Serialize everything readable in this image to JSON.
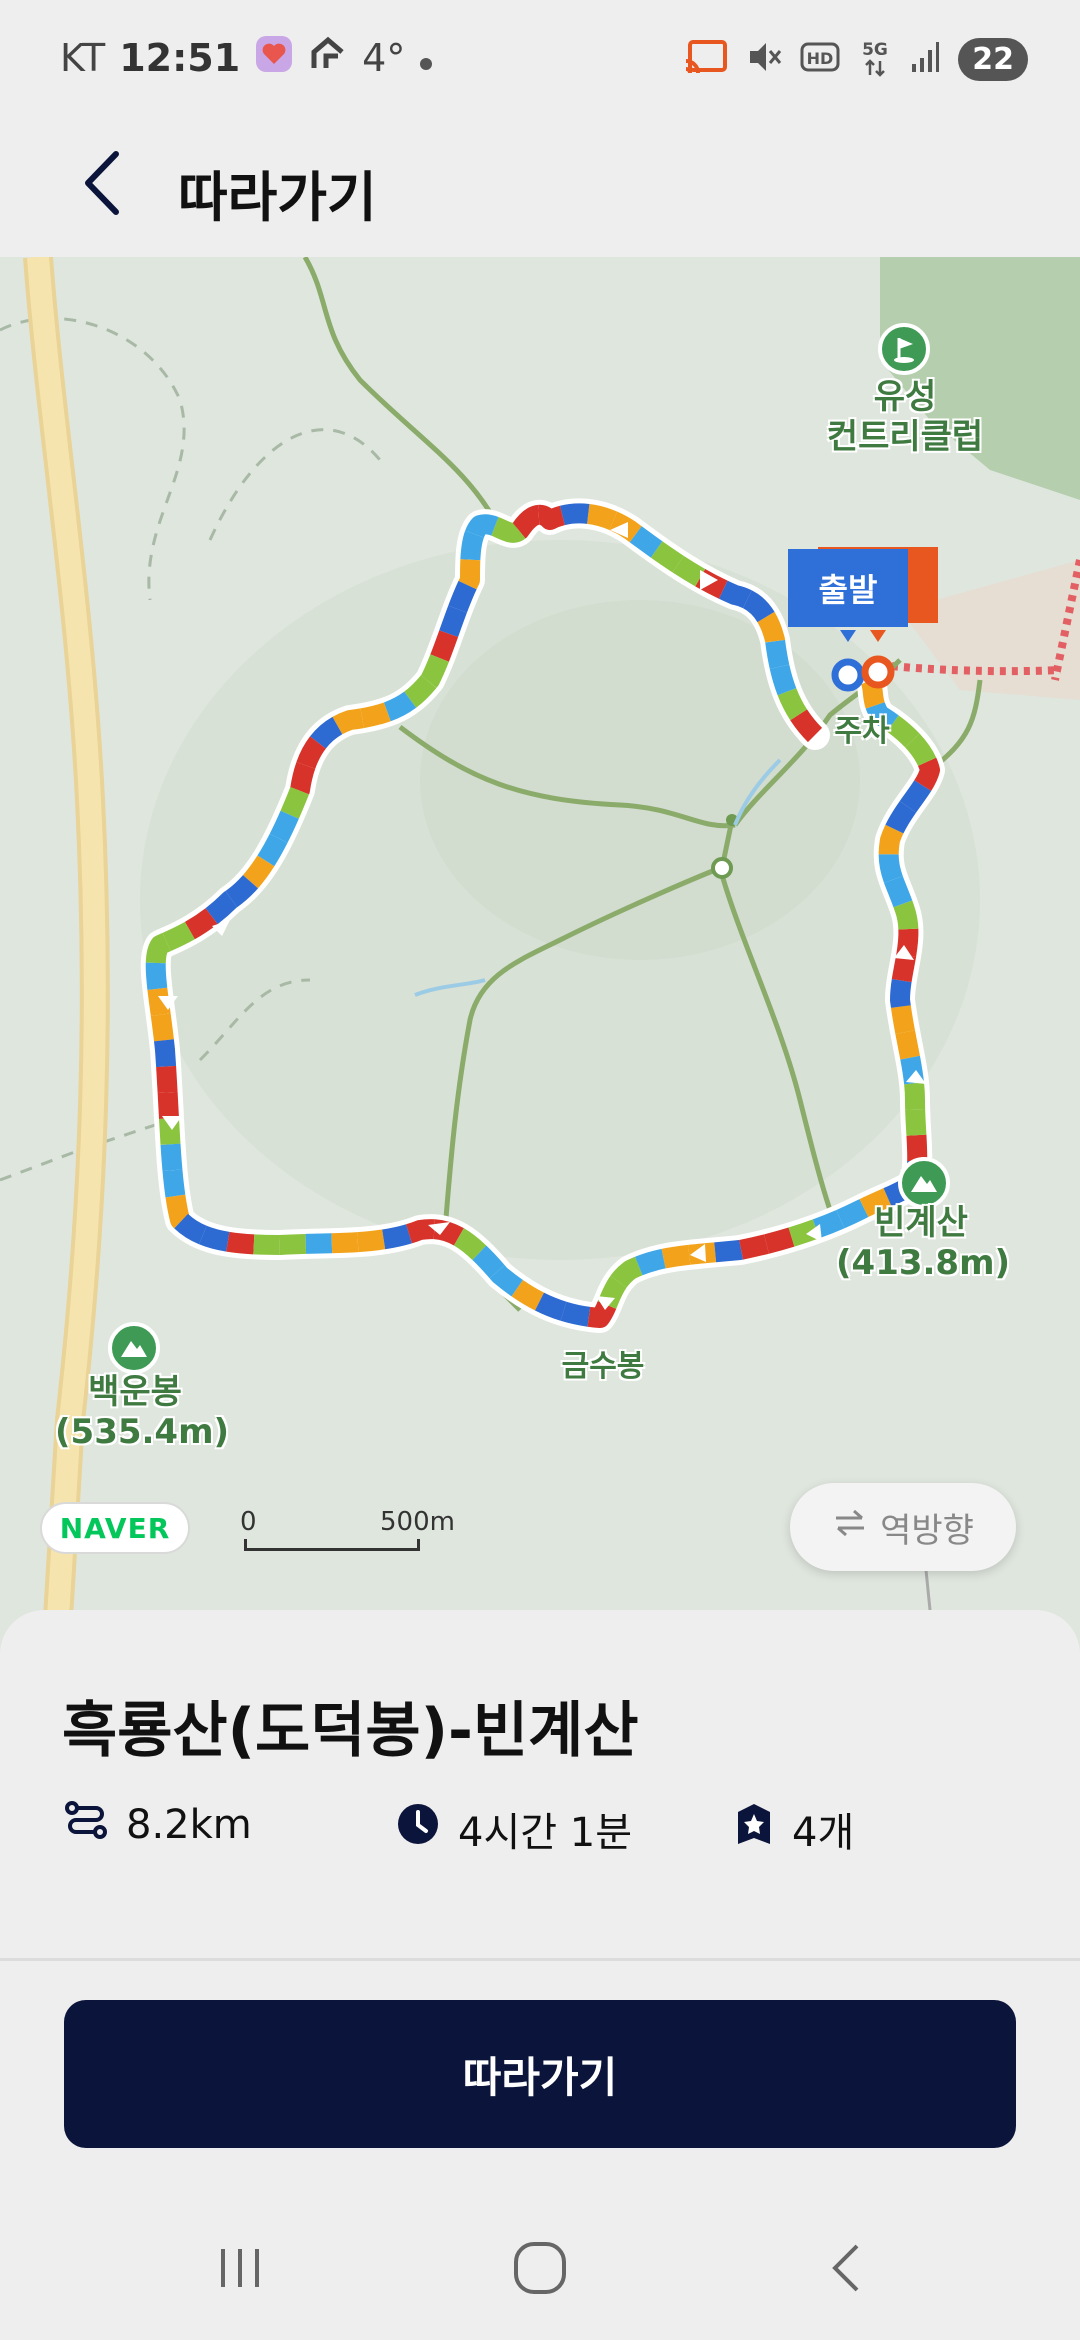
{
  "status_bar": {
    "carrier": "KT",
    "time": "12:51",
    "temperature": "4°",
    "battery": "22",
    "icons": [
      "heart-app-icon",
      "route-app-icon",
      "cast-icon",
      "mute-icon",
      "hd-icon",
      "5g-icon",
      "signal-icon",
      "battery-icon"
    ]
  },
  "header": {
    "title": "따라가기",
    "back_icon": "chevron-left-icon"
  },
  "map": {
    "labels": {
      "country_club": "유성\n컨트리클럽",
      "bingyesan": "빈계산\n(413.8m)",
      "geumsubong": "금수봉",
      "baekunbong": "백운봉\n(535.4m)",
      "parking": "주차"
    },
    "start_flag": "출발",
    "logo": "NAVER",
    "scale_zero": "0",
    "scale_distance": "500m",
    "reverse_button": "역방향",
    "route_colors": [
      "#d7332a",
      "#3fa7e8",
      "#2d6ad2",
      "#8bc43f",
      "#f2a31b"
    ]
  },
  "course": {
    "title": "흑룡산(도덕봉)-빈계산",
    "distance": "8.2km",
    "duration": "4시간 1분",
    "checkpoints": "4개"
  },
  "action": {
    "follow_button": "따라가기"
  },
  "colors": {
    "primary_button": "#0b143a",
    "map_path_green": "#8aab6a",
    "map_road_yellow": "#f2dfa6"
  }
}
